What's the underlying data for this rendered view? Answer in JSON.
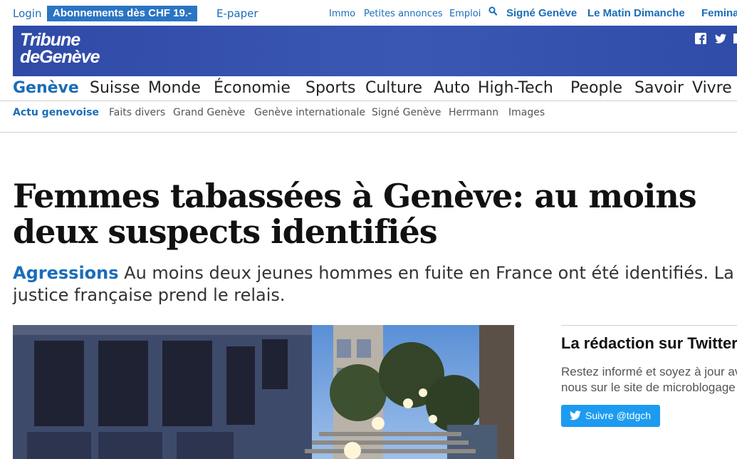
{
  "topbar": {
    "login": "Login",
    "subscription": "Abonnements dès CHF 19.-",
    "epaper": "E-paper",
    "small_links": [
      "Immo",
      "Petites annonces",
      "Emploi"
    ],
    "search_icon": "search-icon",
    "strong_links": [
      "Signé Genève",
      "Le Matin Dimanche",
      "Femina"
    ]
  },
  "masthead": {
    "logo_line1": "Tribune",
    "logo_line2": "deGenève",
    "social_icons": [
      "facebook-icon",
      "twitter-icon",
      "mail-icon"
    ],
    "background": "#3450ad"
  },
  "mainnav": {
    "items": [
      "Genève",
      "Suisse",
      "Monde",
      "Économie",
      "Sports",
      "Culture",
      "Auto",
      "High-Tech",
      "People",
      "Savoir",
      "Vivre"
    ],
    "active": "Genève"
  },
  "subnav": {
    "items": [
      "Actu genevoise",
      "Faits divers",
      "Grand Genève",
      "Genève internationale",
      "Signé Genève",
      "Herrmann",
      "Images"
    ],
    "active": "Actu genevoise"
  },
  "article": {
    "headline": "Femmes tabassées à Genève: au moins deux suspects identifiés",
    "kicker": "Agressions",
    "lead": " Au moins deux jeunes hommes en fuite en France ont été identifiés. La justice française prend le relais."
  },
  "sidebar": {
    "title": "La rédaction sur Twitter",
    "text_line1": "Restez informé et soyez à jour avec",
    "text_line2": "nous sur le site de microblogage",
    "button_label": "Suivre @tdgch",
    "button_color": "#1d9bf0"
  },
  "colors": {
    "accent": "#1b6db8",
    "subscription_bg": "#2a75c3"
  }
}
